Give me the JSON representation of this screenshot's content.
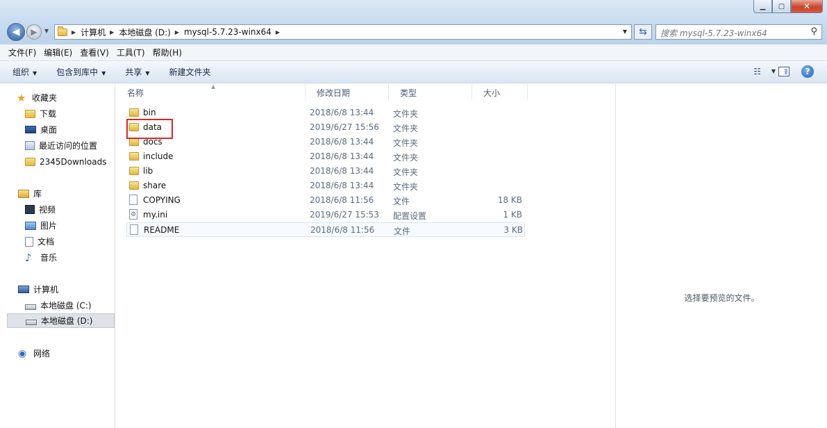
{
  "window": {
    "min_label": "▁",
    "max_label": "▢",
    "close_label": "✕"
  },
  "address": {
    "crumbs": [
      "计算机",
      "本地磁盘 (D:)",
      "mysql-5.7.23-winx64"
    ]
  },
  "search": {
    "placeholder": "搜索 mysql-5.7.23-winx64"
  },
  "menu": [
    "文件(F)",
    "编辑(E)",
    "查看(V)",
    "工具(T)",
    "帮助(H)"
  ],
  "commands": [
    "组织",
    "包含到库中",
    "共享",
    "新建文件夹"
  ],
  "nav": {
    "favorites": "收藏夹",
    "fav_items": [
      "下载",
      "桌面",
      "最近访问的位置",
      "2345Downloads"
    ],
    "libraries": "库",
    "lib_items": [
      "视频",
      "图片",
      "文档",
      "音乐"
    ],
    "computer": "计算机",
    "drives": [
      "本地磁盘 (C:)",
      "本地磁盘 (D:)"
    ],
    "network": "网络"
  },
  "columns": {
    "name": "名称",
    "date": "修改日期",
    "type": "类型",
    "size": "大小"
  },
  "files": [
    {
      "name": "bin",
      "date": "2018/6/8 13:44",
      "type": "文件夹",
      "size": "",
      "kind": "folder"
    },
    {
      "name": "data",
      "date": "2019/6/27 15:56",
      "type": "文件夹",
      "size": "",
      "kind": "folder"
    },
    {
      "name": "docs",
      "date": "2018/6/8 13:44",
      "type": "文件夹",
      "size": "",
      "kind": "folder"
    },
    {
      "name": "include",
      "date": "2018/6/8 13:44",
      "type": "文件夹",
      "size": "",
      "kind": "folder"
    },
    {
      "name": "lib",
      "date": "2018/6/8 13:44",
      "type": "文件夹",
      "size": "",
      "kind": "folder"
    },
    {
      "name": "share",
      "date": "2018/6/8 13:44",
      "type": "文件夹",
      "size": "",
      "kind": "folder"
    },
    {
      "name": "COPYING",
      "date": "2018/6/8 11:56",
      "type": "文件",
      "size": "18 KB",
      "kind": "file"
    },
    {
      "name": "my.ini",
      "date": "2019/6/27 15:53",
      "type": "配置设置",
      "size": "1 KB",
      "kind": "ini"
    },
    {
      "name": "README",
      "date": "2018/6/8 11:56",
      "type": "文件",
      "size": "3 KB",
      "kind": "file"
    }
  ],
  "preview": {
    "empty_text": "选择要预览的文件。"
  },
  "colors": {
    "highlight": "#e02424",
    "accent": "#2f5f9a"
  }
}
